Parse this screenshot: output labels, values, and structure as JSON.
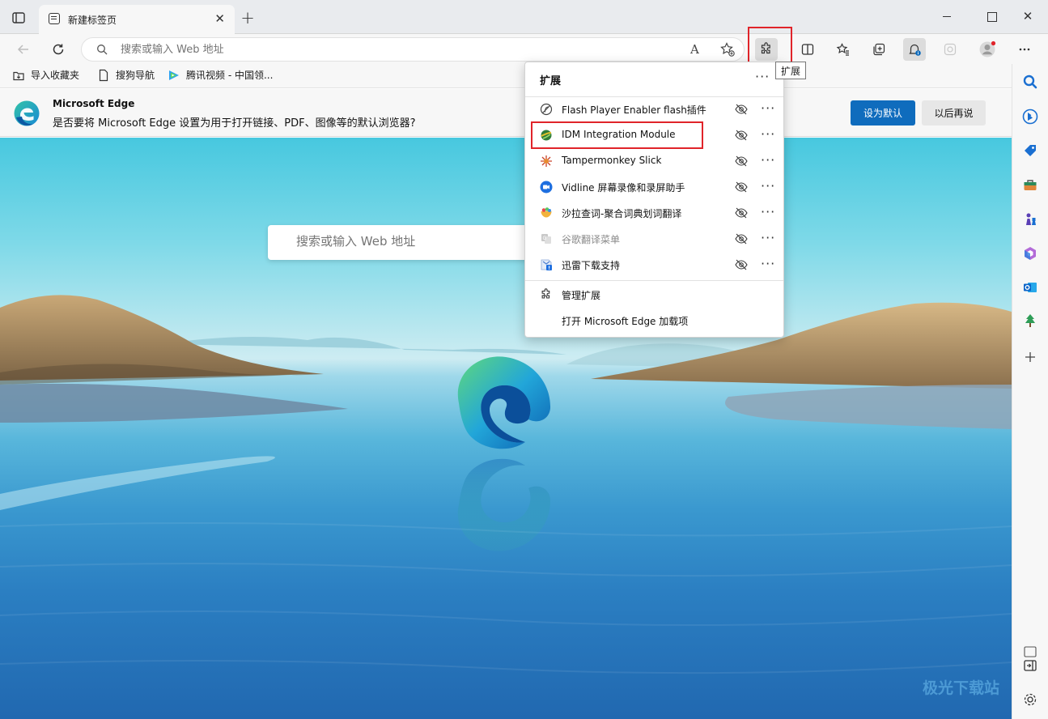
{
  "tab": {
    "title": "新建标签页",
    "close": "✕",
    "new_tab": "+"
  },
  "window": {
    "close": "✕"
  },
  "address_bar": {
    "placeholder": "搜索或输入 Web 地址",
    "read_aloud": "A"
  },
  "extensions_button": {
    "tooltip": "扩展"
  },
  "favorites": [
    {
      "label": "导入收藏夹",
      "icon": "import-favorites-icon"
    },
    {
      "label": "搜狗导航",
      "icon": "page-icon"
    },
    {
      "label": "腾讯视频 - 中国领...",
      "icon": "tencent-video-icon"
    }
  ],
  "infobar": {
    "title": "Microsoft Edge",
    "message": "是否要将 Microsoft Edge 设置为用于打开链接、PDF、图像等的默认浏览器?",
    "primary_label": "设为默认",
    "secondary_label": "以后再说"
  },
  "ntp_search": {
    "placeholder": "搜索或输入 Web 地址"
  },
  "extensions_panel": {
    "title": "扩展",
    "more": "···",
    "items": [
      {
        "name": "Flash Player Enabler flash插件",
        "enabled": true,
        "icon": "flash-icon"
      },
      {
        "name": "IDM Integration Module",
        "enabled": true,
        "icon": "idm-icon"
      },
      {
        "name": "Tampermonkey Slick",
        "enabled": true,
        "icon": "tampermonkey-icon"
      },
      {
        "name": "Vidline 屏幕录像和录屏助手",
        "enabled": true,
        "icon": "vidline-icon"
      },
      {
        "name": "沙拉查词-聚合词典划词翻译",
        "enabled": true,
        "icon": "saladict-icon"
      },
      {
        "name": "谷歌翻译菜单",
        "enabled": false,
        "icon": "translate-icon"
      },
      {
        "name": "迅雷下载支持",
        "enabled": true,
        "icon": "thunder-icon"
      }
    ],
    "manage_label": "管理扩展",
    "addons_label": "打开 Microsoft Edge 加载项"
  },
  "watermark": "极光下载站",
  "colors": {
    "accent": "#0f6cbd",
    "highlight": "#e0242a"
  }
}
